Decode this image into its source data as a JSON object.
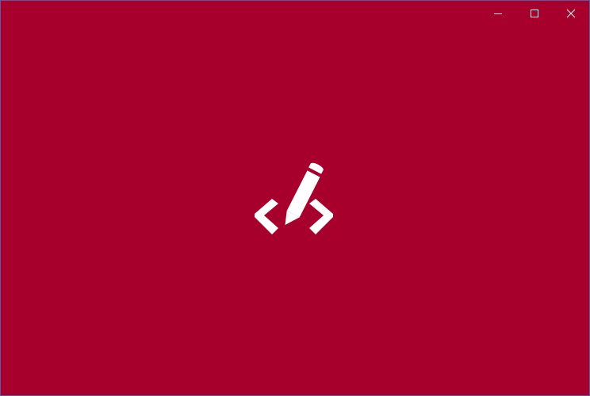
{
  "window": {
    "background_color": "#a8002c",
    "border_color": "#5a5aa8"
  },
  "caption_buttons": [
    {
      "name": "minimize",
      "icon": "minimize-icon"
    },
    {
      "name": "maximize",
      "icon": "maximize-icon"
    },
    {
      "name": "close",
      "icon": "close-icon"
    }
  ],
  "splash": {
    "logo_icon": "code-pencil-logo-icon",
    "logo_color": "#ffffff"
  }
}
